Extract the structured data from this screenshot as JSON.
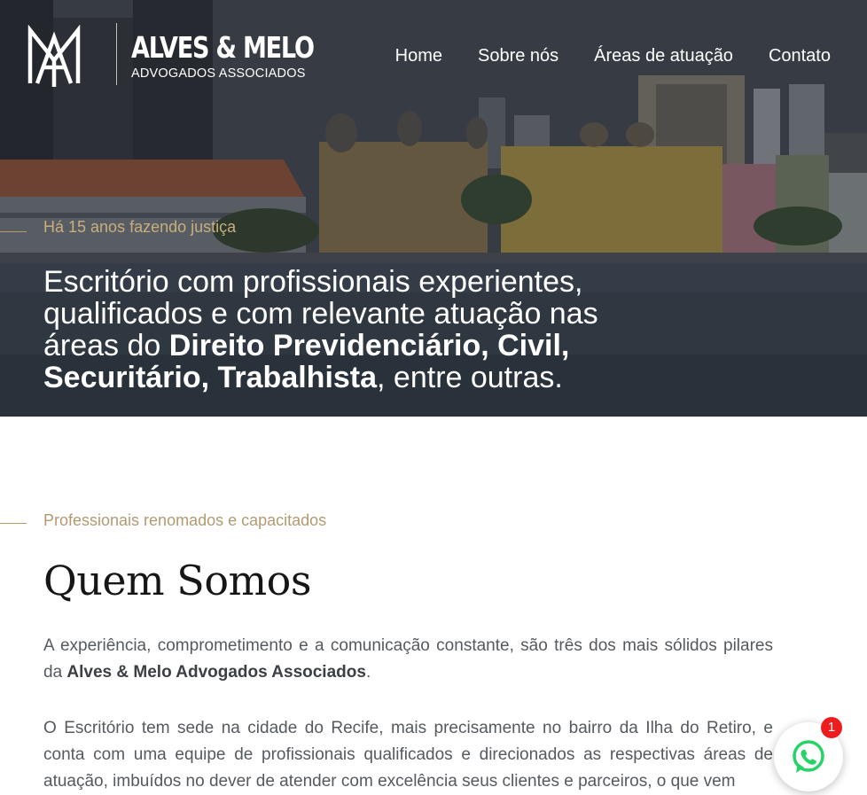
{
  "brand": {
    "title": "ALVES & MELO",
    "subtitle": "ADVOGADOS ASSOCIADOS"
  },
  "nav": {
    "items": [
      {
        "label": "Home"
      },
      {
        "label": "Sobre nós"
      },
      {
        "label": "Áreas de atuação"
      },
      {
        "label": "Contato"
      }
    ]
  },
  "hero": {
    "tagline": "Há 15 anos fazendo justiça",
    "heading_part1": "Escritório com profissionais experientes, qualificados e com relevante atuação nas áreas do ",
    "heading_bold": "Direito Previdenciário, Civil, Securitário, Trabalhista",
    "heading_part2": ", entre outras."
  },
  "about": {
    "tagline": "Professionais renomados e capacitados",
    "title": "Quem Somos",
    "p1_part1": "A experiência, comprometimento e a comunicação constante, são três dos mais sólidos pilares da ",
    "p1_bold": "Alves & Melo Advogados Associados",
    "p1_part2": ".",
    "p2": "O Escritório tem sede na cidade do Recife, mais precisamente no bairro da Ilha do Retiro, e conta com uma equipe de profissionais qualificados e direcionados as respectivas áreas de atuação, imbuídos no dever de atender com excelência seus clientes e parceiros, o que vem"
  },
  "whatsapp": {
    "icon": "whatsapp-icon",
    "badge_count": "1"
  },
  "colors": {
    "accent_gold": "#b29a72",
    "whatsapp_green": "#25d366",
    "badge_red": "#ee1c1c"
  }
}
